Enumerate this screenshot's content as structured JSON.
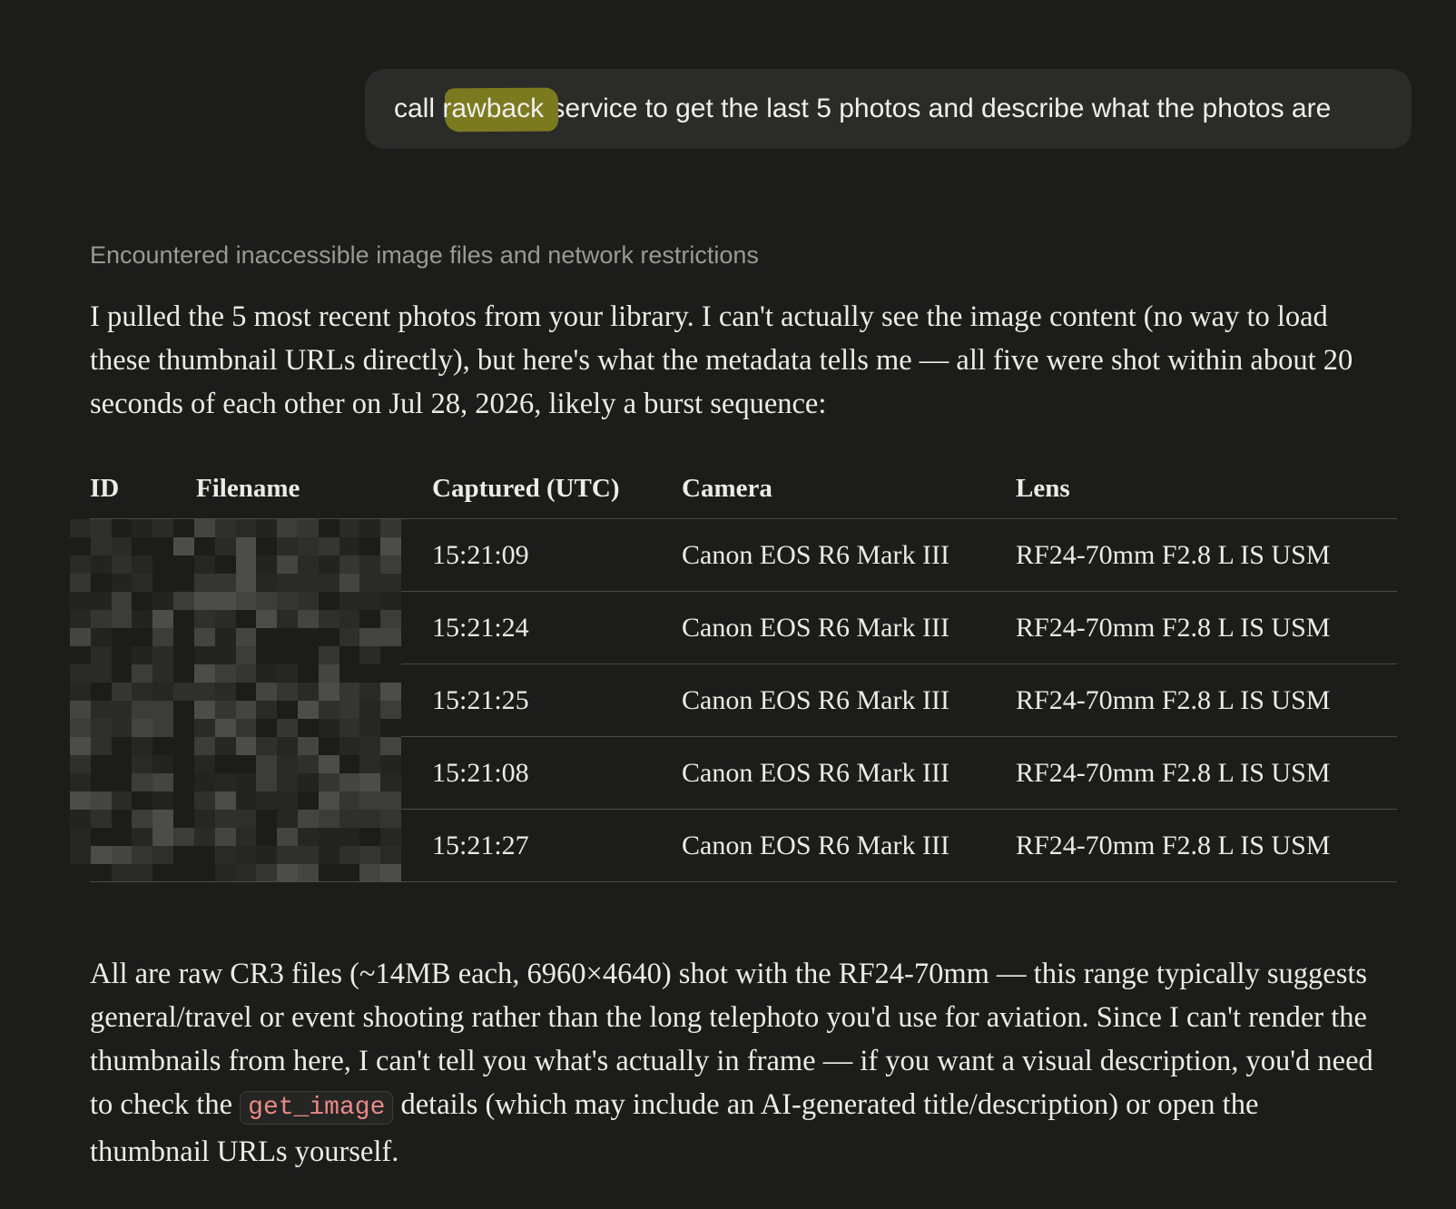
{
  "user_message": {
    "before_highlight": "call ",
    "highlight": "rawback",
    "after_highlight": " service to get the last 5 photos and describe what the photos are"
  },
  "assistant": {
    "thinking_summary": "Encountered inaccessible image files and network restrictions",
    "intro": "I pulled the 5 most recent photos from your library. I can't actually see the image content (no way to load these thumbnail URLs directly), but here's what the metadata tells me — all five were shot within about 20 seconds of each other on Jul 28, 2026, likely a burst sequence:",
    "table": {
      "headers": [
        "ID",
        "Filename",
        "Captured (UTC)",
        "Camera",
        "Lens"
      ],
      "rows": [
        {
          "captured": "15:21:09",
          "camera": "Canon EOS R6 Mark III",
          "lens": "RF24-70mm F2.8 L IS USM"
        },
        {
          "captured": "15:21:24",
          "camera": "Canon EOS R6 Mark III",
          "lens": "RF24-70mm F2.8 L IS USM"
        },
        {
          "captured": "15:21:25",
          "camera": "Canon EOS R6 Mark III",
          "lens": "RF24-70mm F2.8 L IS USM"
        },
        {
          "captured": "15:21:08",
          "camera": "Canon EOS R6 Mark III",
          "lens": "RF24-70mm F2.8 L IS USM"
        },
        {
          "captured": "15:21:27",
          "camera": "Canon EOS R6 Mark III",
          "lens": "RF24-70mm F2.8 L IS USM"
        }
      ]
    },
    "outro_before_code": "All are raw CR3 files (~14MB each, 6960×4640) shot with the RF24-70mm — this range typically suggests general/travel or event shooting rather than the long telephoto you'd use for aviation. Since I can't render the thumbnails from here, I can't tell you what's actually in frame — if you want a visual description, you'd need to check the ",
    "outro_code": "get_image",
    "outro_after_code": " details (which may include an AI-generated title/description) or open the thumbnail URLs yourself."
  },
  "colors": {
    "background": "#1c1c1b",
    "user_bubble": "#2b2b29",
    "highlight": "#7b7a1f",
    "code_text": "#e98a86"
  }
}
